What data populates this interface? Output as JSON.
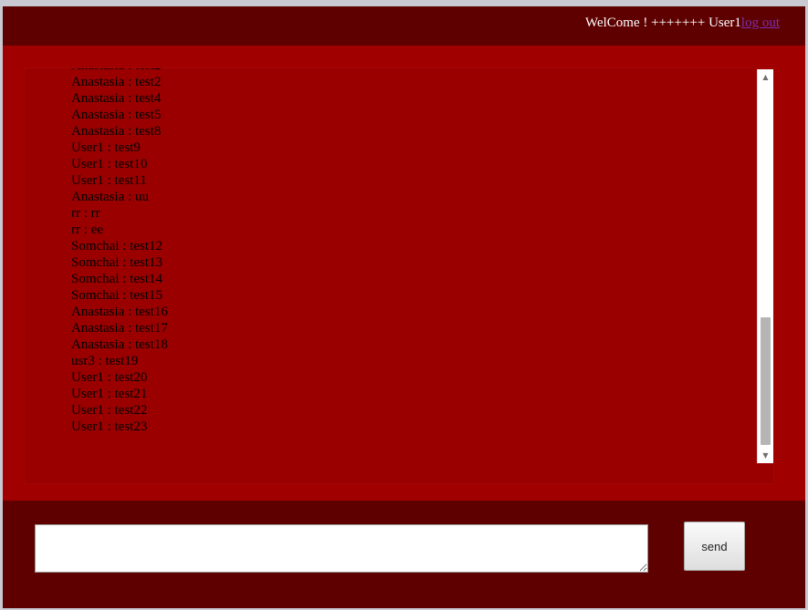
{
  "header": {
    "welcome_text": "WelCome ! +++++++ User1",
    "logout_label": "log out"
  },
  "chat": {
    "messages": [
      "Anastasia : test2",
      "Anastasia : test2",
      "Anastasia : test4",
      "Anastasia : test5",
      "Anastasia : test8",
      "User1 : test9",
      "User1 : test10",
      "User1 : test11",
      "Anastasia : uu",
      "rr : rr",
      "rr : ee",
      "Somchai : test12",
      "Somchai : test13",
      "Somchai : test14",
      "Somchai : test15",
      "Anastasia : test16",
      "Anastasia : test17",
      "Anastasia : test18",
      "usr3 : test19",
      "User1 : test20",
      "User1 : test21",
      "User1 : test22",
      "User1 : test23"
    ],
    "scroll_position": 0.85
  },
  "composer": {
    "value": "",
    "send_label": "send"
  },
  "colors": {
    "header_bg": "#5e0000",
    "panel_bg": "#a00000",
    "chat_bg": "#9b0000",
    "logout_link": "#7a2fb0"
  }
}
